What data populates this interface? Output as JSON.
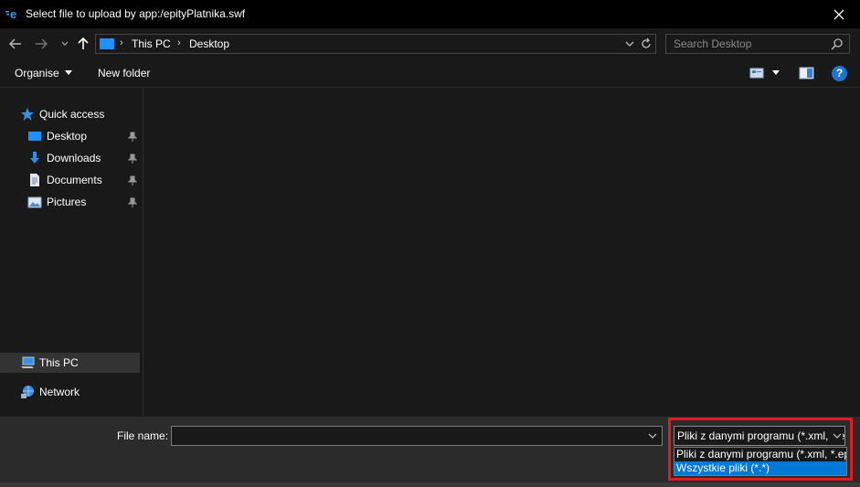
{
  "window": {
    "title": "Select file to upload by app:/epityPlatnika.swf"
  },
  "address_bar": {
    "breadcrumbs": [
      "This PC",
      "Desktop"
    ],
    "search_placeholder": "Search Desktop"
  },
  "command_bar": {
    "organise_label": "Organise",
    "new_folder_label": "New folder",
    "help_glyph": "?"
  },
  "nav_pane": {
    "quick_access_label": "Quick access",
    "pinned": [
      {
        "label": "Desktop",
        "icon": "desktop-icon"
      },
      {
        "label": "Downloads",
        "icon": "download-arrow-icon"
      },
      {
        "label": "Documents",
        "icon": "document-icon"
      },
      {
        "label": "Pictures",
        "icon": "picture-icon"
      }
    ],
    "this_pc_label": "This PC",
    "network_label": "Network"
  },
  "bottom": {
    "file_name_label": "File name:",
    "file_name_value": "",
    "file_type_selected": "Pliki z danymi programu (*.xml, *.epity)",
    "file_type_options": [
      {
        "label": "Pliki z danymi programu (*.xml, *.epity)",
        "selected": false
      },
      {
        "label": "Wszystkie pliki (*.*)",
        "selected": true
      }
    ]
  },
  "colors": {
    "accent": "#0078d7",
    "highlight_box": "#e21b23",
    "background": "#191919"
  }
}
